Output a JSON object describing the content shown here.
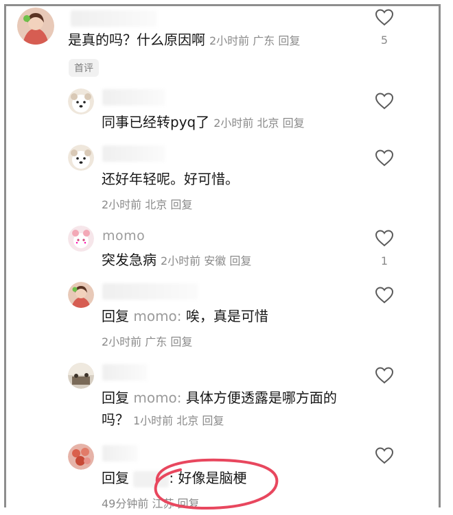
{
  "comments": [
    {
      "text": "是真的吗？什么原因啊",
      "meta": "2小时前 广东 回复",
      "like_count": "5",
      "badge": "首评"
    },
    {
      "text": "同事已经转pyq了",
      "meta": "2小时前 北京 回复"
    },
    {
      "text": "还好年轻呢。好可惜。",
      "meta": "2小时前 北京 回复"
    },
    {
      "username": "momo",
      "text": "突发急病",
      "meta": "2小时前 安徽 回复",
      "like_count": "1"
    },
    {
      "reply_prefix": "回复",
      "reply_to": "momo:",
      "text": "唉，真是可惜",
      "meta": "2小时前 广东 回复"
    },
    {
      "reply_prefix": "回复",
      "reply_to": "momo:",
      "text": "具体方便透露是哪方面的",
      "text_line2": "吗？",
      "meta": "1小时前 北京 回复"
    },
    {
      "reply_prefix": "回复",
      "text": ": 好像是脑梗",
      "meta": "49分钟前 江苏 回复"
    }
  ],
  "icons": {
    "like": "heart-outline-icon"
  },
  "colors": {
    "annotation": "#e8475e",
    "meta_text": "#8a8a8a"
  }
}
